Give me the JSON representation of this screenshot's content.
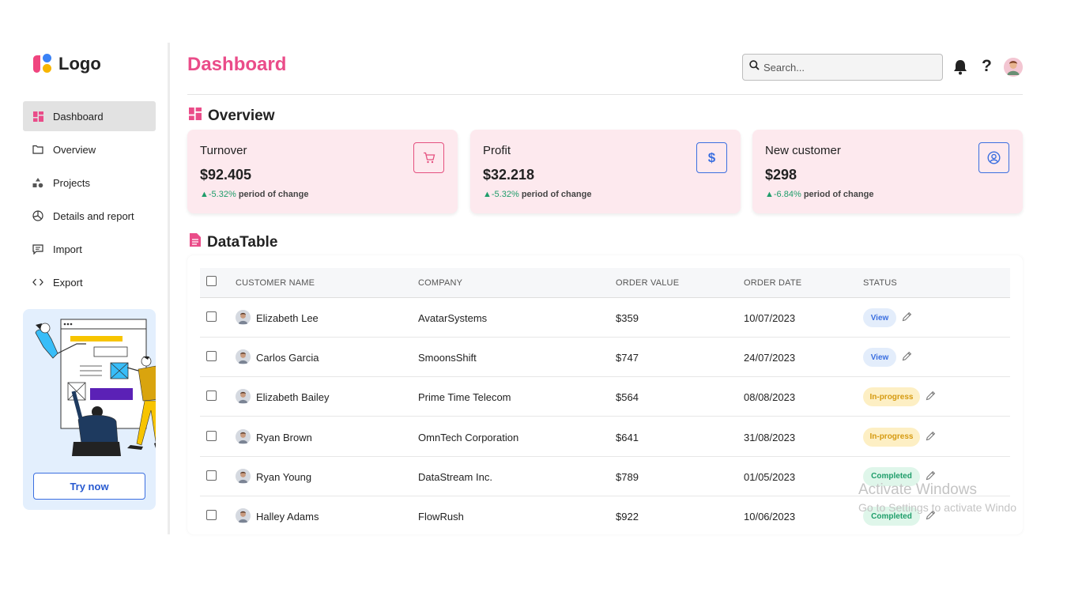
{
  "logo": {
    "text": "Logo"
  },
  "sidebar": {
    "items": [
      {
        "label": "Dashboard",
        "icon": "dashboard-grid-icon",
        "active": true
      },
      {
        "label": "Overview",
        "icon": "folder-icon"
      },
      {
        "label": "Projects",
        "icon": "shapes-icon"
      },
      {
        "label": "Details and report",
        "icon": "pie-chart-icon"
      },
      {
        "label": "Import",
        "icon": "comment-icon"
      },
      {
        "label": "Export",
        "icon": "code-icon"
      }
    ],
    "promo": {
      "button": "Try now"
    }
  },
  "header": {
    "title": "Dashboard",
    "search_placeholder": "Search...",
    "help": "?"
  },
  "overview": {
    "title": "Overview",
    "cards": [
      {
        "label": "Turnover",
        "value": "$92.405",
        "change": "-5.32%",
        "change_text": "period of change",
        "icon": "cart-icon",
        "icon_color": "#e5507f"
      },
      {
        "label": "Profit",
        "value": "$32.218",
        "change": "-5.32%",
        "change_text": "period of change",
        "icon": "dollar-icon",
        "icon_color": "#3b6fe0"
      },
      {
        "label": "New customer",
        "value": "$298",
        "change": "-6.84%",
        "change_text": "period of change",
        "icon": "user-circle-icon",
        "icon_color": "#3b6fe0"
      }
    ]
  },
  "datatable": {
    "title": "DataTable",
    "columns": [
      "CUSTOMER NAME",
      "COMPANY",
      "ORDER VALUE",
      "ORDER DATE",
      "STATUS"
    ],
    "rows": [
      {
        "name": "Elizabeth Lee",
        "company": "AvatarSystems",
        "value": "$359",
        "date": "10/07/2023",
        "status": "View"
      },
      {
        "name": "Carlos Garcia",
        "company": "SmoonsShift",
        "value": "$747",
        "date": "24/07/2023",
        "status": "View"
      },
      {
        "name": "Elizabeth Bailey",
        "company": "Prime Time Telecom",
        "value": "$564",
        "date": "08/08/2023",
        "status": "In-progress"
      },
      {
        "name": "Ryan Brown",
        "company": "OmnTech Corporation",
        "value": "$641",
        "date": "31/08/2023",
        "status": "In-progress"
      },
      {
        "name": "Ryan Young",
        "company": "DataStream Inc.",
        "value": "$789",
        "date": "01/05/2023",
        "status": "Completed"
      },
      {
        "name": "Halley Adams",
        "company": "FlowRush",
        "value": "$922",
        "date": "10/06/2023",
        "status": "Completed"
      }
    ]
  },
  "status_colors": {
    "View": {
      "bg": "#e3edfb",
      "fg": "#3b6fe0"
    },
    "In-progress": {
      "bg": "#fdefc4",
      "fg": "#d69a10"
    },
    "Completed": {
      "bg": "#dff6ea",
      "fg": "#1f9d6a"
    }
  },
  "watermark": {
    "line1": "Activate Windows",
    "line2": "Go to Settings to activate Windo"
  }
}
